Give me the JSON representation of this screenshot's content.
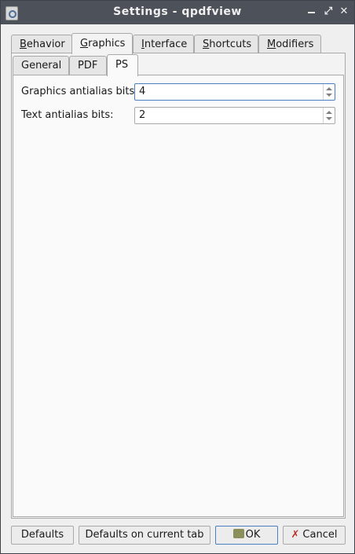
{
  "window": {
    "title": "Settings - qpdfview"
  },
  "main_tabs": [
    {
      "label_pre": "",
      "label_u": "B",
      "label_post": "ehavior"
    },
    {
      "label_pre": "",
      "label_u": "G",
      "label_post": "raphics"
    },
    {
      "label_pre": "",
      "label_u": "I",
      "label_post": "nterface"
    },
    {
      "label_pre": "",
      "label_u": "S",
      "label_post": "hortcuts"
    },
    {
      "label_pre": "",
      "label_u": "M",
      "label_post": "odifiers"
    }
  ],
  "sub_tabs": [
    "General",
    "PDF",
    "PS"
  ],
  "fields": {
    "graphics_label": "Graphics antialias bits:",
    "graphics_value": "4",
    "text_label": "Text antialias bits:",
    "text_value": "2"
  },
  "buttons": {
    "defaults": "Defaults",
    "defaults_tab": "Defaults on current tab",
    "ok": "OK",
    "cancel": "Cancel"
  }
}
